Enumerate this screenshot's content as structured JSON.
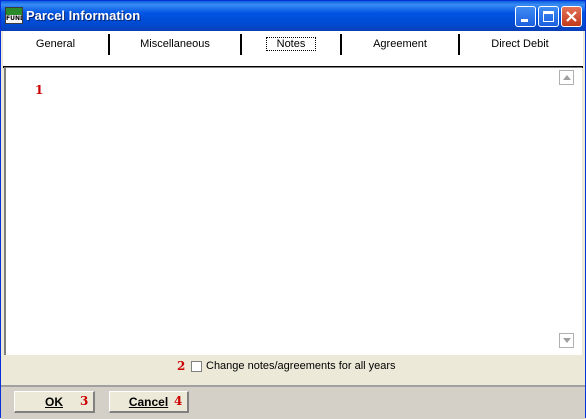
{
  "window": {
    "title": "Parcel Information",
    "app_icon_text": "FUND",
    "colors": {
      "title_bar": "#0054e3",
      "face": "#ece9d8",
      "marker": "#cc0000"
    }
  },
  "tabs": [
    {
      "label": "General",
      "active": false
    },
    {
      "label": "Miscellaneous",
      "active": false
    },
    {
      "label": "Notes",
      "active": true
    },
    {
      "label": "Agreement",
      "active": false
    },
    {
      "label": "Direct Debit",
      "active": false
    }
  ],
  "notes": {
    "text": "",
    "marker": "1"
  },
  "options": {
    "change_all_years_label": "Change notes/agreements for all years",
    "change_all_years_checked": false,
    "marker": "2"
  },
  "buttons": {
    "ok_label": "OK",
    "ok_marker": "3",
    "cancel_label": "Cancel",
    "cancel_marker": "4"
  },
  "icons": {
    "minimize": "minimize-icon",
    "maximize": "maximize-icon",
    "close": "close-icon",
    "scroll_up": "scroll-up-arrow-icon",
    "scroll_down": "scroll-down-arrow-icon"
  }
}
